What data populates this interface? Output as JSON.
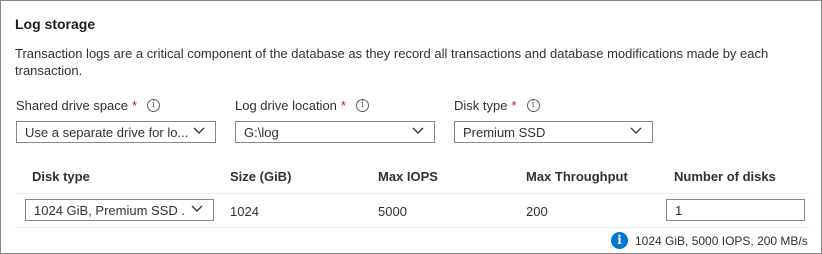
{
  "section": {
    "title": "Log storage",
    "description": "Transaction logs are a critical component of the database as they record all transactions and database modifications made by each transaction."
  },
  "fields": {
    "shared_drive": {
      "label": "Shared drive space",
      "required_mark": "*",
      "value": "Use a separate drive for lo..."
    },
    "log_location": {
      "label": "Log drive location",
      "required_mark": "*",
      "value": "G:\\log"
    },
    "disk_type": {
      "label": "Disk type",
      "required_mark": "*",
      "value": "Premium SSD"
    }
  },
  "info_glyph": "i",
  "table": {
    "headers": [
      "Disk type",
      "Size (GiB)",
      "Max IOPS",
      "Max Throughput",
      "Number of disks"
    ],
    "row": {
      "disk_type": "1024 GiB, Premium SSD ...",
      "size": "1024",
      "max_iops": "5000",
      "max_throughput": "200",
      "number_of_disks": "1"
    }
  },
  "summary": {
    "icon": "info-icon",
    "text": "1024 GiB, 5000 IOPS, 200 MB/s"
  },
  "colors": {
    "accent": "#0078d4",
    "required": "#a4262c",
    "border": "#8a8886"
  }
}
